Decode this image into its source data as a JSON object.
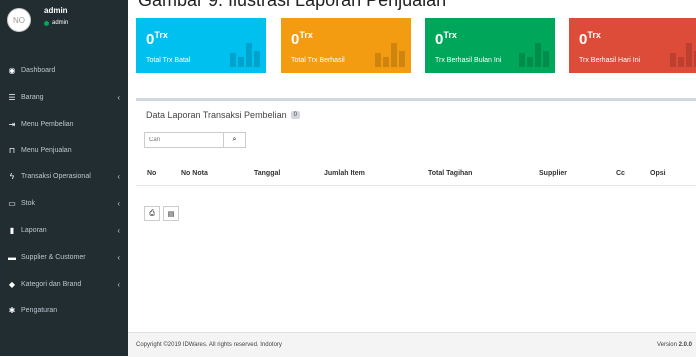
{
  "caption": "Gambar 9. Ilustrasi Laporan Penjualan",
  "user": {
    "avatar_text": "NO",
    "name": "admin",
    "status": "admin"
  },
  "nav": [
    {
      "label": "Dashboard",
      "icon": "dashboard-icon",
      "chevron": ""
    },
    {
      "label": "Barang",
      "icon": "list-icon",
      "chevron": "‹"
    },
    {
      "label": "Menu Pembelian",
      "icon": "sign-in-icon",
      "chevron": ""
    },
    {
      "label": "Menu Penjualan",
      "icon": "cart-icon",
      "chevron": ""
    },
    {
      "label": "Transaksi Operasional",
      "icon": "bolt-icon",
      "chevron": "‹"
    },
    {
      "label": "Stok",
      "icon": "monitor-icon",
      "chevron": "‹"
    },
    {
      "label": "Laporan",
      "icon": "bar-chart-icon",
      "chevron": "‹"
    },
    {
      "label": "Supplier & Customer",
      "icon": "truck-icon",
      "chevron": "‹"
    },
    {
      "label": "Kategori dan Brand",
      "icon": "tag-icon",
      "chevron": "‹"
    },
    {
      "label": "Pengaturan",
      "icon": "gear-icon",
      "chevron": ""
    }
  ],
  "stats": [
    {
      "value": "0",
      "unit": "Trx",
      "label": "Total Trx Batal",
      "color": "#00c0ef"
    },
    {
      "value": "0",
      "unit": "Trx",
      "label": "Total Trx Berhasil",
      "color": "#f39c12"
    },
    {
      "value": "0",
      "unit": "Trx",
      "label": "Trx Berhasil Bulan Ini",
      "color": "#00a65a"
    },
    {
      "value": "0",
      "unit": "Trx",
      "label": "Trx Berhasil Hari Ini",
      "color": "#dd4b39"
    }
  ],
  "report": {
    "title": "Data Laporan Transaksi Pembelian",
    "count": "0",
    "search_placeholder": "Cari",
    "columns": [
      "No",
      "No Nota",
      "Tanggal",
      "Jumlah Item",
      "Total Tagihan",
      "Supplier",
      "Cc",
      "Opsi"
    ]
  },
  "footer": {
    "copyright": "Copyright ©2019 IDWares. All rights reserved. Indotory",
    "version_label": "Version",
    "version": "2.0.0"
  }
}
